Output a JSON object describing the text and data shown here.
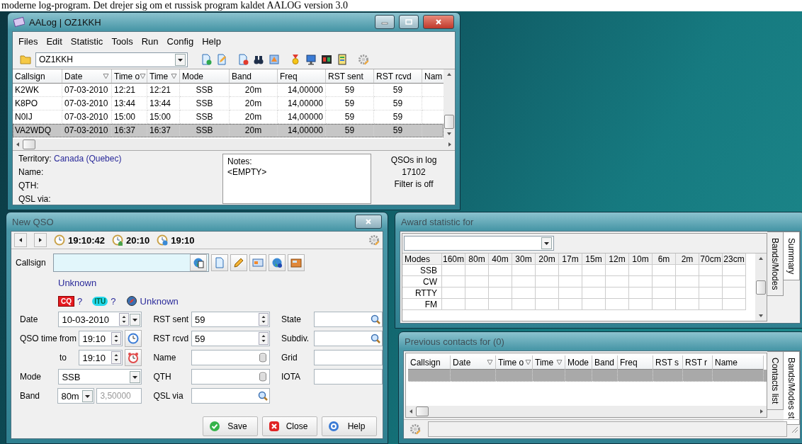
{
  "document_text": "moderne log-program. Det drejer sig om et russisk program kaldet AALOG version 3.0",
  "main_window": {
    "title": "AALog | OZ1KKH",
    "active": true,
    "menu": [
      "Files",
      "Edit",
      "Statistic",
      "Tools",
      "Run",
      "Config",
      "Help"
    ],
    "log_selector": "OZ1KKH",
    "table": {
      "columns": [
        {
          "label": "Callsign",
          "sortable": false
        },
        {
          "label": "Date",
          "sortable": true
        },
        {
          "label": "Time o",
          "sortable": true
        },
        {
          "label": "Time",
          "sortable": true
        },
        {
          "label": "Mode",
          "sortable": false
        },
        {
          "label": "Band",
          "sortable": false
        },
        {
          "label": "Freq",
          "sortable": false
        },
        {
          "label": "RST sent",
          "sortable": false
        },
        {
          "label": "RST rcvd",
          "sortable": false
        },
        {
          "label": "Nam",
          "sortable": false
        }
      ],
      "rows": [
        {
          "cells": [
            "K2WK",
            "07-03-2010",
            "12:21",
            "12:21",
            "SSB",
            "20m",
            "14,00000",
            "59",
            "59"
          ],
          "selected": false
        },
        {
          "cells": [
            "K8PO",
            "07-03-2010",
            "13:44",
            "13:44",
            "SSB",
            "20m",
            "14,00000",
            "59",
            "59"
          ],
          "selected": false
        },
        {
          "cells": [
            "N0IJ",
            "07-03-2010",
            "15:00",
            "15:00",
            "SSB",
            "20m",
            "14,00000",
            "59",
            "59"
          ],
          "selected": false
        },
        {
          "cells": [
            "VA2WDQ",
            "07-03-2010",
            "16:37",
            "16:37",
            "SSB",
            "20m",
            "14,00000",
            "59",
            "59"
          ],
          "selected": true
        }
      ]
    },
    "details": {
      "territory_label": "Territory:",
      "territory": "Canada (Quebec)",
      "labels": [
        "Name:",
        "QTH:",
        "QSL via:"
      ]
    },
    "notes": {
      "label": "Notes:",
      "text": "<EMPTY>"
    },
    "summary": [
      "QSOs in log",
      "17102",
      "Filter is off"
    ]
  },
  "new_qso": {
    "title": "New QSO",
    "active": false,
    "clocks": [
      {
        "kind": "local",
        "time": "19:10:42"
      },
      {
        "kind": "home",
        "time": "20:10"
      },
      {
        "kind": "utc",
        "time": "19:10"
      }
    ],
    "callsign_label": "Callsign",
    "country": "Unknown",
    "zones": [
      {
        "kind": "cq",
        "badge": "CQ",
        "value": "?"
      },
      {
        "kind": "itu",
        "badge": "ITU",
        "value": "?"
      }
    ],
    "continent": "Unknown",
    "field_columns": [
      [
        {
          "label": "Date",
          "value": "10-03-2010",
          "kind": "date"
        },
        {
          "label": "QSO time from",
          "value": "19:10",
          "kind": "time_start"
        },
        {
          "label": "to",
          "value": "19:10",
          "kind": "time_end"
        },
        {
          "label": "Mode",
          "value": "SSB",
          "kind": "combo"
        },
        {
          "label": "Band",
          "value": "80m",
          "kind": "band",
          "frequency": "3,50000",
          "frequency_disabled": true
        }
      ],
      [
        {
          "label": "RST sent",
          "value": "59",
          "kind": "spin"
        },
        {
          "label": "RST rcvd",
          "value": "59",
          "kind": "spin"
        },
        {
          "label": "Name",
          "kind": "lookup"
        },
        {
          "label": "QTH",
          "kind": "lookup"
        },
        {
          "label": "QSL via",
          "kind": "search"
        }
      ],
      [
        {
          "label": "State",
          "kind": "search"
        },
        {
          "label": "Subdiv.",
          "kind": "search"
        },
        {
          "label": "Grid",
          "kind": "text"
        },
        {
          "label": "IOTA",
          "kind": "text"
        }
      ]
    ],
    "buttons": [
      {
        "kind": "save",
        "label": "Save"
      },
      {
        "kind": "close",
        "label": "Close"
      },
      {
        "kind": "help",
        "label": "Help"
      }
    ]
  },
  "award_window": {
    "title": "Award statistic for",
    "active": false,
    "columns": [
      "Modes",
      "160m",
      "80m",
      "40m",
      "30m",
      "20m",
      "17m",
      "15m",
      "12m",
      "10m",
      "6m",
      "2m",
      "70cm",
      "23cm"
    ],
    "rows": [
      "SSB",
      "CW",
      "RTTY",
      "FM"
    ],
    "side_tabs": [
      {
        "label": "Bands/Modes",
        "selected": true
      },
      {
        "label": "Summary",
        "selected": false
      }
    ]
  },
  "contacts_window": {
    "title": "Previous contacts for  (0)",
    "active": false,
    "columns": [
      {
        "label": "Callsign",
        "sortable": false
      },
      {
        "label": "Date",
        "sortable": true
      },
      {
        "label": "Time o",
        "sortable": true
      },
      {
        "label": "Time",
        "sortable": true
      },
      {
        "label": "Mode",
        "sortable": false
      },
      {
        "label": "Band",
        "sortable": false
      },
      {
        "label": "Freq",
        "sortable": false
      },
      {
        "label": "RST s",
        "sortable": false
      },
      {
        "label": "RST r",
        "sortable": false
      },
      {
        "label": "Name",
        "sortable": false
      }
    ],
    "rows": [
      {
        "selected": true
      }
    ],
    "side_tabs": [
      {
        "label": "Contacts list",
        "selected": true
      },
      {
        "label": "Bands/Modes st",
        "selected": false
      }
    ]
  }
}
